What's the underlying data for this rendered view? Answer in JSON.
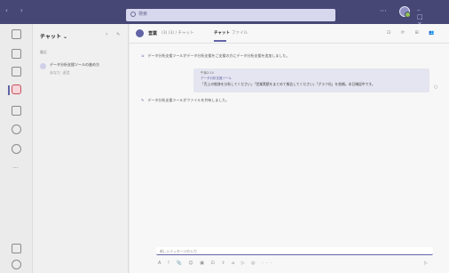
{
  "titlebar": {
    "nav": "‹ ›",
    "search_placeholder": "検索",
    "more": "···",
    "window_controls": "– □ ×"
  },
  "rail": {
    "more": "···"
  },
  "chatlist": {
    "title": "チャット ⌄",
    "header_icons": "▿ ✎",
    "section": "最近",
    "items": [
      {
        "name": "データ分析支援ツールの進め方",
        "sub": "あなた: 返信"
      }
    ]
  },
  "chat_header": {
    "title": "営業",
    "meta": "(3)  (3)  / チャット",
    "tab_active": "チャット",
    "tab_other": "ファイル",
    "right_icons": "⊡ ⟳ ⊞ 👥"
  },
  "messages": {
    "system1": "データ分析支援ツールがデータ分析支援をご支援の方にデータ分析支援を追加しました。",
    "bubble": {
      "time": "午後2:14",
      "author": "データ分析支援ツール",
      "text": "「売上の推移を分析してください」「営業実績をまとめて報告してください」「グラフ化」を依頼。本日確認中です。"
    },
    "system2": "データ分析支援ツールがファイルを共有しました。",
    "bubble_more": "○"
  },
  "compose": {
    "placeholder": "新しいメッセージの入力",
    "toolbar": "A ! 📎 ☺ ▣ ⊡ ⇪ ⌂ ▷ ◎ ··· ",
    "send": "▷"
  }
}
